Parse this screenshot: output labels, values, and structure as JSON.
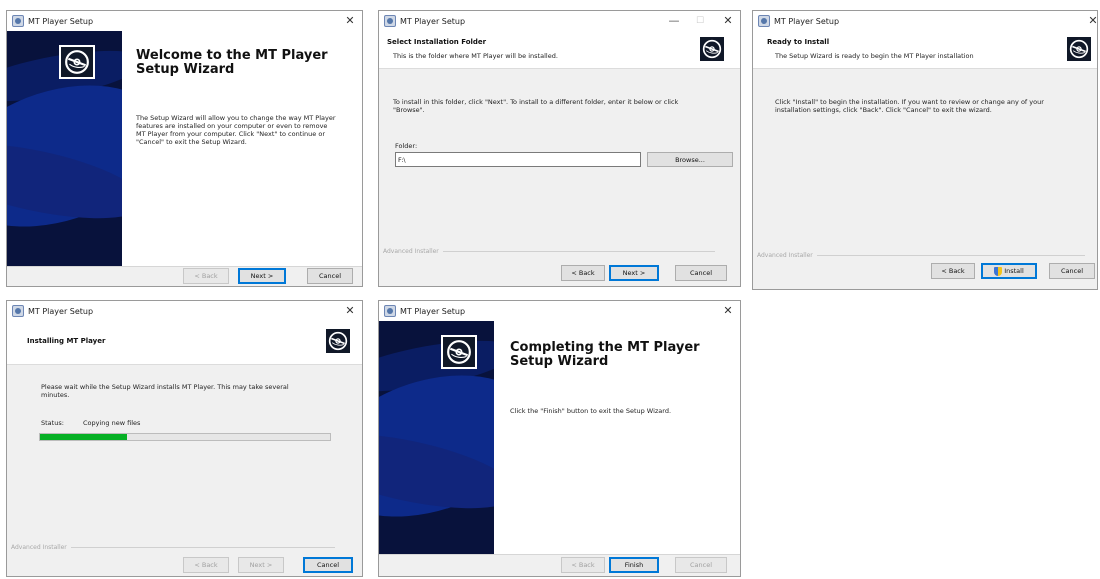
{
  "window_title": "MT Player Setup",
  "branding": "Advanced Installer",
  "icons": {
    "app": "installer-app-icon",
    "logo": "disc-logo-icon",
    "close": "close-icon",
    "minimize": "minimize-icon",
    "maximize": "maximize-icon",
    "shield": "uac-shield-icon"
  },
  "close_glyph": "✕",
  "min_glyph": "—",
  "max_glyph": "☐",
  "welcome": {
    "title_line1": "Welcome to the MT Player",
    "title_line2": "Setup Wizard",
    "body_line1": "The Setup Wizard will allow you to change the way MT Player",
    "body_line2": "features are installed on your computer or even to remove",
    "body_line3": "MT Player from your computer.  Click \"Next\" to continue or",
    "body_line4": "\"Cancel\" to exit the Setup Wizard.",
    "back_label": "< Back",
    "next_label": "Next >",
    "cancel_label": "Cancel"
  },
  "folder": {
    "header_title": "Select Installation Folder",
    "header_sub": "This is the folder where MT Player will be installed.",
    "instr_line1": "To install in this folder, click \"Next\". To install to a different folder, enter it below or click",
    "instr_line2": "\"Browse\".",
    "folder_label": "Folder:",
    "folder_value": "F:\\",
    "browse_label": "Browse...",
    "back_label": "< Back",
    "next_label": "Next >",
    "cancel_label": "Cancel"
  },
  "ready": {
    "header_title": "Ready to Install",
    "header_sub": "The Setup Wizard is ready to begin the MT Player installation",
    "instr_line1": "Click \"Install\" to begin the installation.  If you want to review or change any of your",
    "instr_line2": "installation settings, click \"Back\".  Click \"Cancel\" to exit the wizard.",
    "back_label": "< Back",
    "install_label": "Install",
    "cancel_label": "Cancel"
  },
  "installing": {
    "header_title": "Installing MT Player",
    "wait_line1": "Please wait while the Setup Wizard installs MT Player.  This may take several",
    "wait_line2": "minutes.",
    "status_label": "Status:",
    "status_value": "Copying new files",
    "progress": 0.3,
    "back_label": "< Back",
    "next_label": "Next >",
    "cancel_label": "Cancel"
  },
  "complete": {
    "title_line1": "Completing the MT Player",
    "title_line2": "Setup Wizard",
    "body": "Click the \"Finish\" button to exit the Setup Wizard.",
    "back_label": "< Back",
    "finish_label": "Finish",
    "cancel_label": "Cancel"
  }
}
